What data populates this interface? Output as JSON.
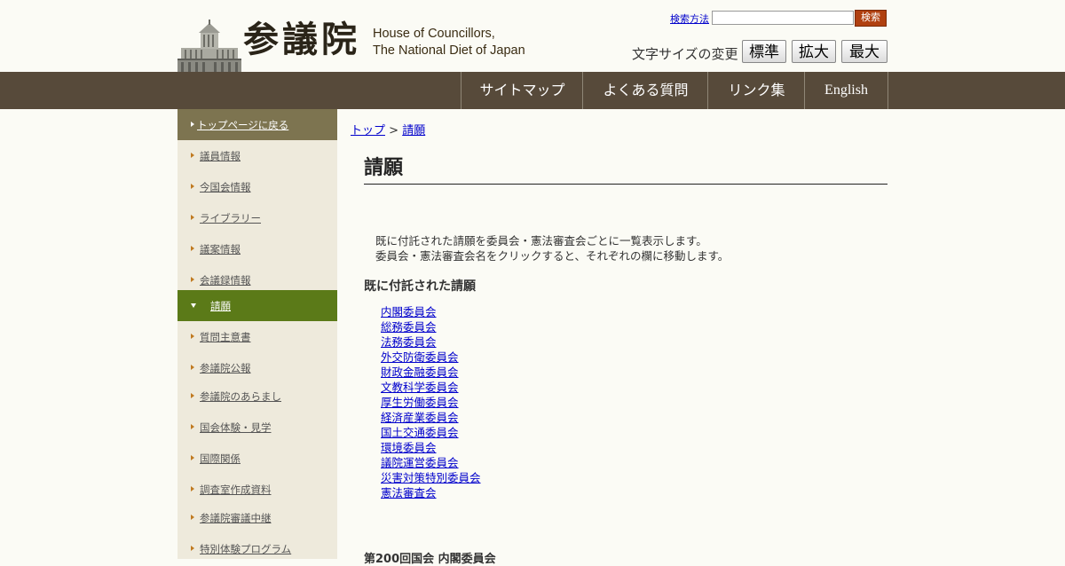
{
  "header": {
    "brand_kanji": "参議院",
    "brand_en_line1": "House of Councillors,",
    "brand_en_line2": "The National Diet of Japan",
    "search_howto": "検索方法",
    "search_placeholder": "",
    "search_button": "検索",
    "font_size_label": "文字サイズの変更",
    "font_standard": "標準",
    "font_large": "拡大",
    "font_max": "最大"
  },
  "nav": {
    "sitemap": "サイトマップ",
    "faq": "よくある質問",
    "links": "リンク集",
    "english": "English"
  },
  "sidebar": {
    "top_link": "トップページに戻る",
    "items": [
      "議員情報",
      "今国会情報",
      "ライブラリー",
      "議案情報",
      "会議録情報",
      "請願",
      "質問主意書",
      "参議院公報",
      "参議院のあらまし",
      "国会体験・見学",
      "国際関係",
      "調査室作成資料",
      "参議院審議中継",
      "特別体験プログラム"
    ]
  },
  "main": {
    "breadcrumb_top": "トップ",
    "breadcrumb_sep": ">",
    "breadcrumb_current": "請願",
    "title": "請願",
    "intro_line1": "既に付託された請願を委員会・憲法審査会ごとに一覧表示します。",
    "intro_line2": "委員会・憲法審査会名をクリックすると、それぞれの欄に移動します。",
    "section_heading": "既に付託された請願",
    "committees": [
      "内閣委員会",
      "総務委員会",
      "法務委員会",
      "外交防衛委員会",
      "財政金融委員会",
      "文教科学委員会",
      "厚生労働委員会",
      "経済産業委員会",
      "国土交通委員会",
      "環境委員会",
      "議院運営委員会",
      "災害対策特別委員会",
      "憲法審査会"
    ],
    "sub_heading": "第200回国会 内閣委員会"
  }
}
